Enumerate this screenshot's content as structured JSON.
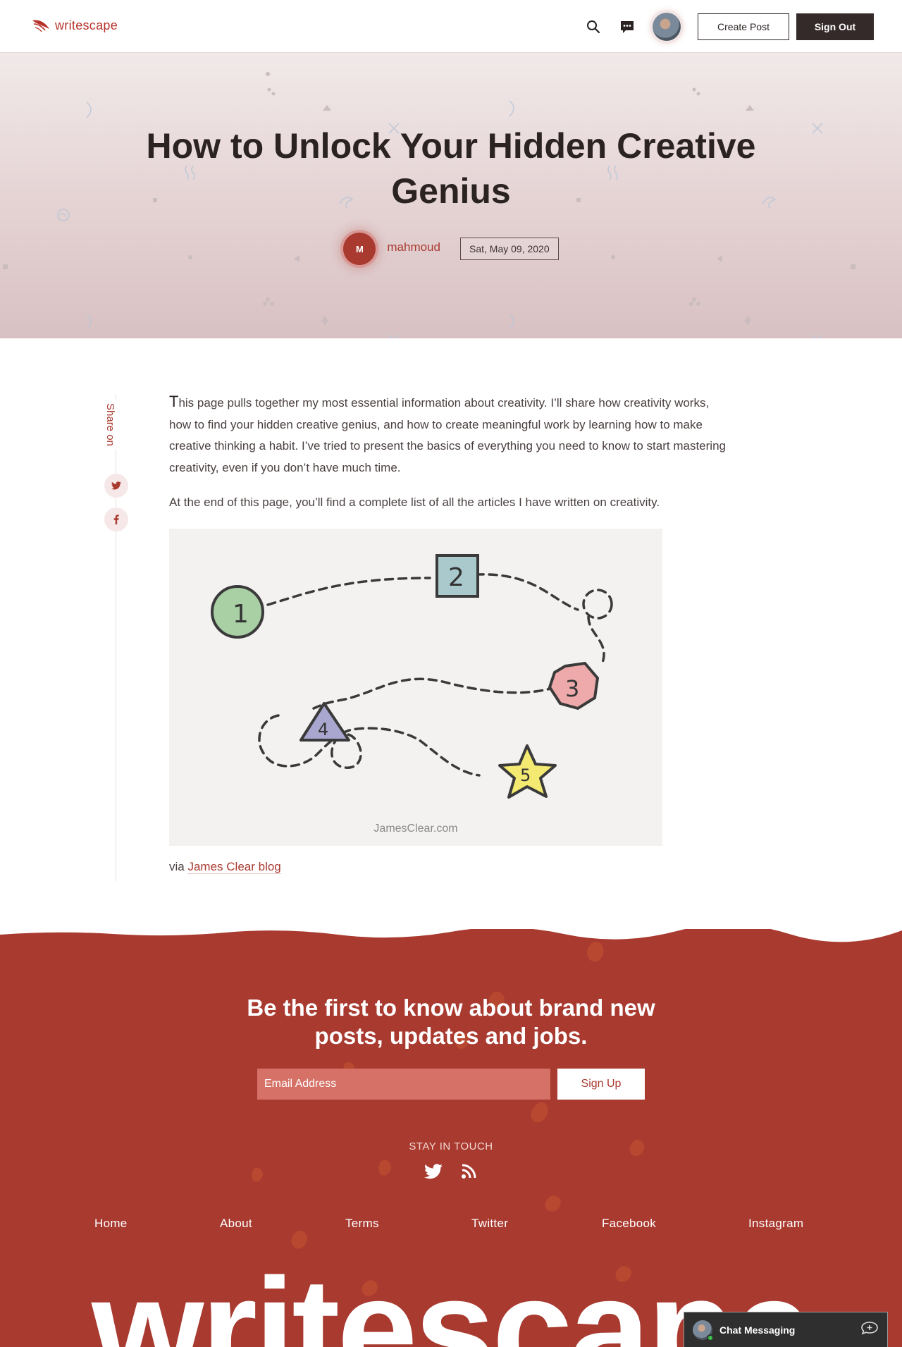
{
  "header": {
    "brand": "writescape",
    "create_post_label": "Create Post",
    "sign_out_label": "Sign Out"
  },
  "post": {
    "title": "How to Unlock Your Hidden Creative Genius",
    "author_initial": "M",
    "author_name": "mahmoud",
    "date": "Sat, May 09, 2020",
    "share_label": "Share on",
    "dropcap": "T",
    "paragraph1_rest": "his page pulls together my most essential information about creativity. I’ll share how creativity works, how to find your hidden creative genius, and how to create meaningful work by learning how to make creative thinking a habit. I’ve tried to present the basics of everything you need to know to start mastering creativity, even if you don’t have much time.",
    "paragraph2": "At the end of this page, you’ll find a complete list of all the articles I have written on creativity.",
    "figure_numbers": [
      "1",
      "2",
      "3",
      "4",
      "5"
    ],
    "figure_credit": "JamesClear.com",
    "caption_prefix": "via",
    "caption_link": "James Clear blog"
  },
  "footer": {
    "headline": "Be the first to know about brand new posts, updates and jobs.",
    "email_placeholder": "Email Address",
    "signup_label": "Sign Up",
    "stay_in_touch": "STAY IN TOUCH",
    "links": [
      "Home",
      "About",
      "Terms",
      "Twitter",
      "Facebook",
      "Instagram"
    ],
    "big_brand": "writescape"
  },
  "chat": {
    "label": "Chat Messaging"
  },
  "colors": {
    "brand": "#a93a30",
    "dark": "#352a2a",
    "hero_top": "#f1e9e9",
    "hero_bottom": "#d8c1c3"
  }
}
